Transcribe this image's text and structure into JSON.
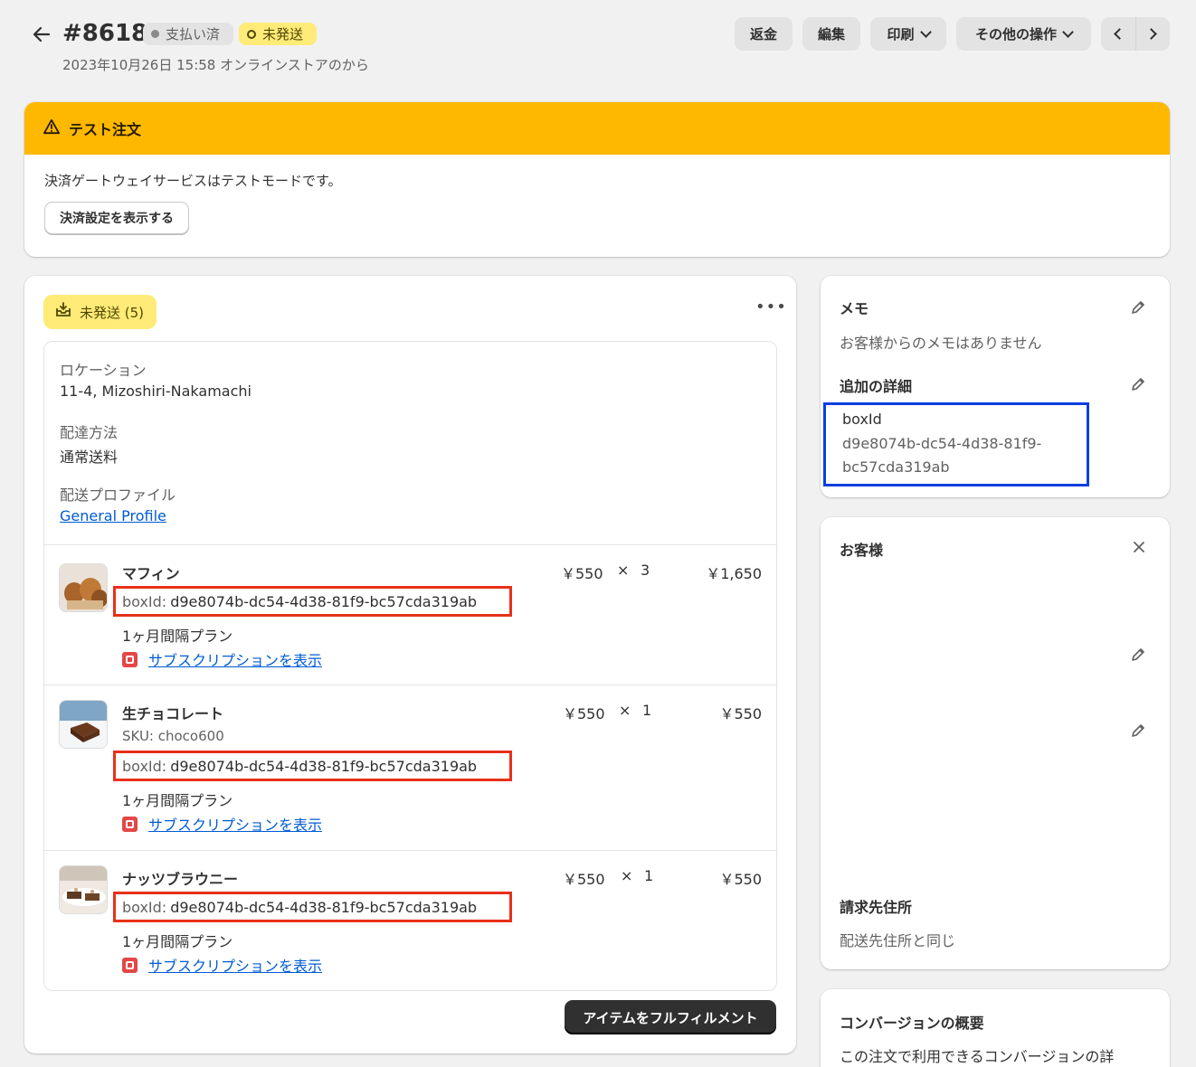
{
  "header": {
    "order_number": "#8618",
    "badges": {
      "paid": "支払い済",
      "unfulfilled": "未発送"
    },
    "subline": "2023年10月26日 15:58 オンラインストアのから",
    "buttons": {
      "refund": "返金",
      "edit": "編集",
      "print": "印刷",
      "more_actions": "その他の操作"
    }
  },
  "banner": {
    "title": "テスト注文",
    "message": "決済ゲートウェイサービスはテストモードです。",
    "button": "決済設定を表示する",
    "color": "#ffb800"
  },
  "fulfillment": {
    "status_pill": "未発送 (5)",
    "location_label": "ロケーション",
    "location_value": "11-4, Mizoshiri-Nakamachi",
    "delivery_label": "配達方法",
    "delivery_value": "通常送料",
    "profile_label": "配送プロファイル",
    "profile_link": "General Profile",
    "items": [
      {
        "name": "マフィン",
        "sku": "",
        "boxid_key": "boxId:",
        "boxid_value": "d9e8074b-dc54-4d38-81f9-bc57cda319ab",
        "unit_price": "￥550",
        "times": "×",
        "qty": "3",
        "total": "￥1,650",
        "plan": "1ヶ月間隔プラン",
        "sub_link": "サブスクリプションを表示"
      },
      {
        "name": "生チョコレート",
        "sku": "SKU: choco600",
        "boxid_key": "boxId:",
        "boxid_value": "d9e8074b-dc54-4d38-81f9-bc57cda319ab",
        "unit_price": "￥550",
        "times": "×",
        "qty": "1",
        "total": "￥550",
        "plan": "1ヶ月間隔プラン",
        "sub_link": "サブスクリプションを表示"
      },
      {
        "name": "ナッツブラウニー",
        "sku": "",
        "boxid_key": "boxId:",
        "boxid_value": "d9e8074b-dc54-4d38-81f9-bc57cda319ab",
        "unit_price": "￥550",
        "times": "×",
        "qty": "1",
        "total": "￥550",
        "plan": "1ヶ月間隔プラン",
        "sub_link": "サブスクリプションを表示"
      }
    ],
    "fulfill_button": "アイテムをフルフィルメント"
  },
  "notes": {
    "title": "メモ",
    "empty": "お客様からのメモはありません",
    "details_title": "追加の詳細",
    "detail_key": "boxId",
    "detail_value_line1": "d9e8074b-dc54-4d38-81f9-",
    "detail_value_line2": "bc57cda319ab"
  },
  "customer": {
    "title": "お客様",
    "billing_title": "請求先住所",
    "billing_value": "配送先住所と同じ"
  },
  "conversion": {
    "title": "コンバージョンの概要",
    "text": "この注文で利用できるコンバージョンの詳"
  },
  "icons": [
    "back-arrow-icon",
    "warning-icon",
    "package-icon",
    "more-dots-icon",
    "pencil-icon",
    "close-icon",
    "subscription-icon",
    "chevron-left-icon",
    "chevron-right-icon",
    "chevron-down-icon"
  ]
}
